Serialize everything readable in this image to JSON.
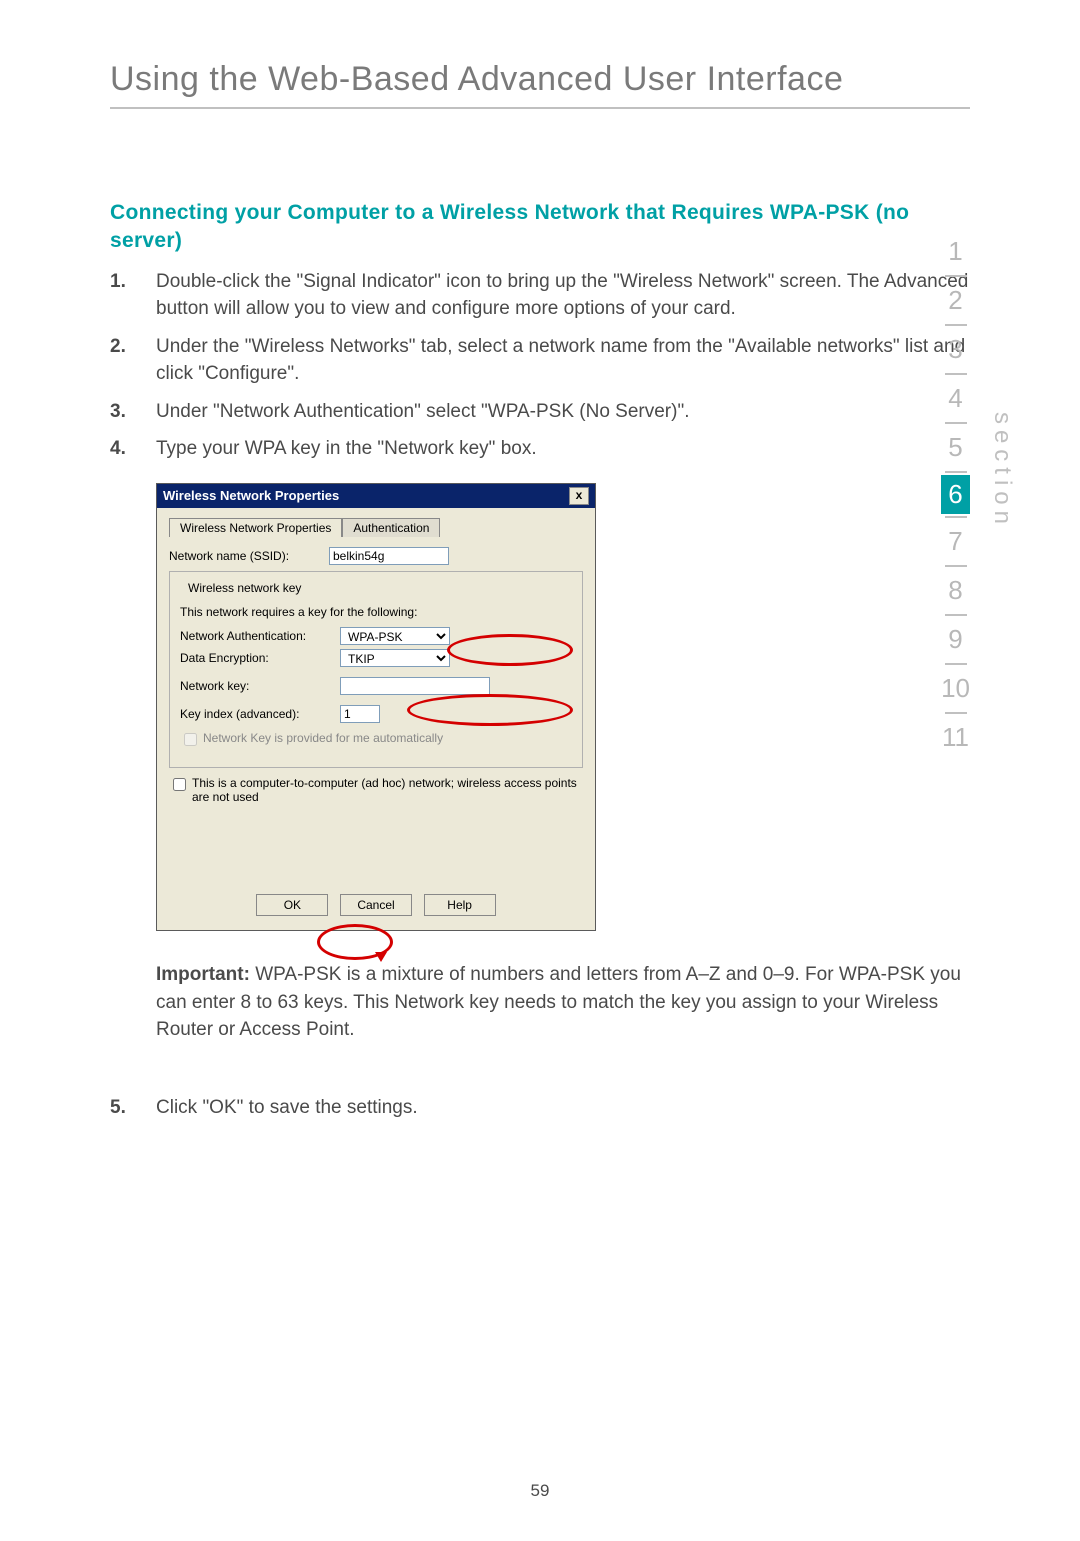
{
  "chapter": {
    "title": "Using the Web-Based Advanced User Interface"
  },
  "subtitle": "Connecting your Computer to a Wireless Network that Requires WPA-PSK (no server)",
  "steps": [
    {
      "n": "1.",
      "text": "Double-click the \"Signal Indicator\" icon to bring up the \"Wireless Network\" screen. The Advanced button will allow you to view and configure more options of your card."
    },
    {
      "n": "2.",
      "text": "Under the \"Wireless Networks\" tab, select a network name from the \"Available networks\" list and click \"Configure\"."
    },
    {
      "n": "3.",
      "text": "Under \"Network Authentication\" select \"WPA-PSK (No Server)\"."
    },
    {
      "n": "4.",
      "text": "Type your WPA key in the \"Network key\" box."
    }
  ],
  "steps2": [
    {
      "n": "5.",
      "text": "Click \"OK\" to save the settings."
    }
  ],
  "important": {
    "label": "Important:",
    "text": " WPA-PSK is a mixture of numbers and letters from A–Z and 0–9. For WPA-PSK you can enter 8 to 63 keys. This Network key needs to match the key you assign to your Wireless Router or Access Point."
  },
  "dialog": {
    "title": "Wireless Network Properties",
    "close": "x",
    "tabs": [
      "Wireless Network Properties",
      "Authentication"
    ],
    "ssid_label": "Network name (SSID):",
    "ssid_value": "belkin54g",
    "fieldset_legend": "Wireless network key",
    "hint": "This network requires a key for the following:",
    "auth_label": "Network Authentication:",
    "auth_value": "WPA-PSK",
    "enc_label": "Data Encryption:",
    "enc_value": "TKIP",
    "key_label": "Network key:",
    "key_value": "",
    "keyindex_label": "Key index (advanced):",
    "keyindex_value": "1",
    "chk_auto": "Network Key is provided for me automatically",
    "chk_adhoc": "This is a computer-to-computer (ad hoc) network; wireless access points are not used",
    "btn_ok": "OK",
    "btn_cancel": "Cancel",
    "btn_help": "Help"
  },
  "sectionNav": {
    "label": "section",
    "items": [
      "1",
      "2",
      "3",
      "4",
      "5",
      "6",
      "7",
      "8",
      "9",
      "10",
      "11"
    ],
    "active": "6"
  },
  "pageNumber": "59"
}
